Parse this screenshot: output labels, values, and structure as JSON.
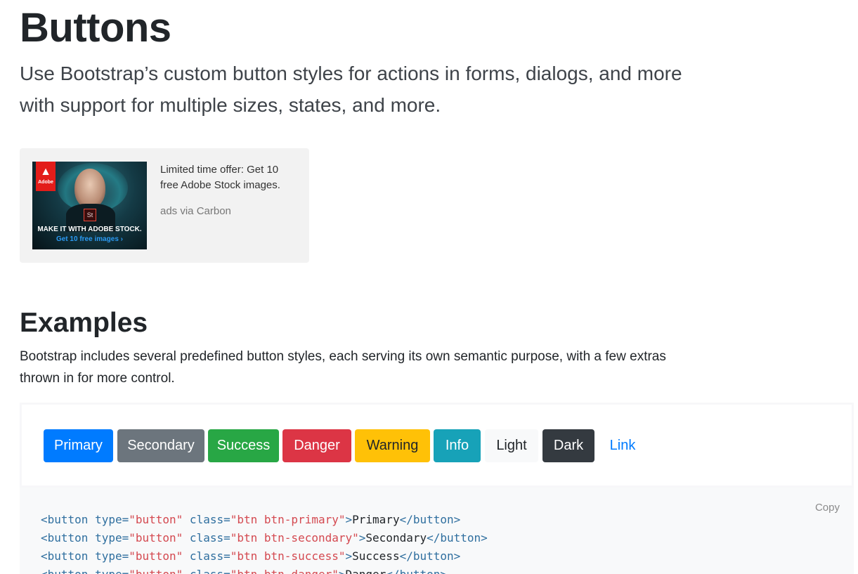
{
  "header": {
    "title": "Buttons",
    "lead": "Use Bootstrap’s custom button styles for actions in forms, dialogs, and more with support for multiple sizes, states, and more."
  },
  "ad": {
    "logo_text": "Adobe",
    "badge_text": "St",
    "image_headline": "MAKE IT WITH ADOBE STOCK.",
    "image_cta": "Get 10 free images ›",
    "text": "Limited time offer: Get 10 free Adobe Stock images.",
    "powered_by": "ads via Carbon"
  },
  "examples": {
    "heading": "Examples",
    "description": "Bootstrap includes several predefined button styles, each serving its own semantic purpose, with a few extras thrown in for more control.",
    "buttons": [
      {
        "label": "Primary",
        "color": "#007bff"
      },
      {
        "label": "Secondary",
        "color": "#6c757d"
      },
      {
        "label": "Success",
        "color": "#28a745"
      },
      {
        "label": "Danger",
        "color": "#dc3545"
      },
      {
        "label": "Warning",
        "color": "#ffc107"
      },
      {
        "label": "Info",
        "color": "#17a2b8"
      },
      {
        "label": "Light",
        "color": "#f8f9fa"
      },
      {
        "label": "Dark",
        "color": "#343a40"
      },
      {
        "label": "Link",
        "color": "#007bff"
      }
    ]
  },
  "code": {
    "copy_label": "Copy",
    "lines": [
      {
        "open": "<button",
        "type_attr": " type=",
        "type_val": "\"button\"",
        "class_attr": " class=",
        "class_val": "\"btn btn-primary\"",
        "gt": ">",
        "text": "Primary",
        "close": "</button>"
      },
      {
        "open": "<button",
        "type_attr": " type=",
        "type_val": "\"button\"",
        "class_attr": " class=",
        "class_val": "\"btn btn-secondary\"",
        "gt": ">",
        "text": "Secondary",
        "close": "</button>"
      },
      {
        "open": "<button",
        "type_attr": " type=",
        "type_val": "\"button\"",
        "class_attr": " class=",
        "class_val": "\"btn btn-success\"",
        "gt": ">",
        "text": "Success",
        "close": "</button>"
      },
      {
        "open": "<button",
        "type_attr": " type=",
        "type_val": "\"button\"",
        "class_attr": " class=",
        "class_val": "\"btn btn-danger\"",
        "gt": ">",
        "text": "Danger",
        "close": "</button>"
      }
    ]
  }
}
